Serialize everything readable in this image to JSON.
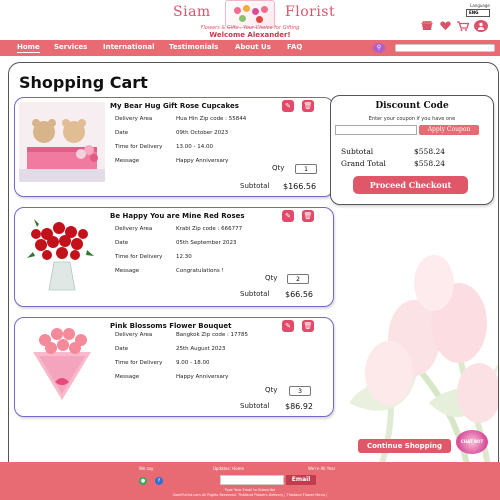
{
  "header": {
    "brand_left": "Siam",
    "brand_right": "Florist",
    "tagline": "Flowers & Gifts , Your Choice for Gifting",
    "welcome": "Welcome Alexander!",
    "language_label": "Language",
    "language_value": "ENG",
    "icons": [
      "shop-icon",
      "favorite-icon",
      "cart-icon",
      "user-icon"
    ]
  },
  "nav": {
    "items": [
      "Home",
      "Services",
      "International",
      "Testimonials",
      "About Us",
      "FAQ"
    ],
    "active": "Home",
    "search_placeholder": ""
  },
  "page_title": "Shopping Cart",
  "cart": {
    "qty_label": "Qty",
    "subtotal_label": "Subtotal",
    "field_labels": {
      "delivery_area": "Delivery Area",
      "date": "Date",
      "time": "Time for Delivery",
      "message": "Message"
    },
    "items": [
      {
        "title": "My Bear Hug Gift Rose Cupcakes",
        "delivery_area": "Hua Hin Zip code : 55844",
        "date": "09th October 2023",
        "time": "13.00 - 14.00",
        "message": "Happy Anniversary",
        "qty": "1",
        "subtotal": "$166.56"
      },
      {
        "title": "Be Happy You are Mine Red Roses",
        "delivery_area": "Krabi Zip code : 666777",
        "date": "05th September 2023",
        "time": "12.30",
        "message": "Congratulations !",
        "qty": "2",
        "subtotal": "$66.56"
      },
      {
        "title": "Pink Blossoms Flower Bouquet",
        "delivery_area": "Bangkok Zip code : 17785",
        "date": "25th August 2023",
        "time": "9.00 - 18.00",
        "message": "Happy Anniversary",
        "qty": "3",
        "subtotal": "$86.92"
      }
    ]
  },
  "discount": {
    "title": "Discount Code",
    "subtitle": "Enter your coupon if you have one",
    "coupon_value": "",
    "apply_label": "Apply Coupon",
    "subtotal_label": "Subtotal",
    "subtotal_value": "$558.24",
    "grand_total_label": "Grand Total",
    "grand_total_value": "$558.24",
    "checkout_label": "Proceed Checkout"
  },
  "continue_label": "Continue Shopping",
  "chat_label": "CHAT BOT",
  "footer": {
    "col1": "We say",
    "col2": "Updates: Home",
    "col3": "We're All Year",
    "subscribe_label": "Email",
    "subscribe_hint": "Type Your Email to Subscribe",
    "copyright": "SiamFlorist.com All Rights Reserved. Thailand Flowers Delivery | Thailand Flower Menu |"
  },
  "colors": {
    "brand": "#d9546b",
    "nav": "#e86a72",
    "card_border": "#7a63c9",
    "button": "#e0576a"
  }
}
